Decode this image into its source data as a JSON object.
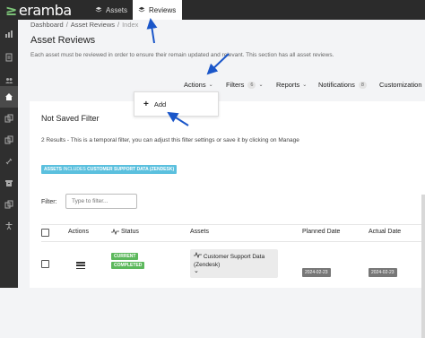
{
  "app": {
    "brand": "eramba"
  },
  "top_tabs": [
    {
      "label": "Assets",
      "icon": "layers-icon"
    },
    {
      "label": "Reviews",
      "icon": "layers-icon",
      "active": true
    }
  ],
  "sidebar": {
    "items": [
      {
        "icon": "chart-icon"
      },
      {
        "icon": "document-icon"
      },
      {
        "icon": "users-icon"
      },
      {
        "icon": "home-icon",
        "active": true
      },
      {
        "icon": "copy-icon"
      },
      {
        "icon": "copy-icon"
      },
      {
        "icon": "link-icon"
      },
      {
        "icon": "box-icon"
      },
      {
        "icon": "copy-icon"
      },
      {
        "icon": "accessibility-icon"
      }
    ]
  },
  "breadcrumb": {
    "items": [
      "Dashboard",
      "Asset Reviews",
      "Index"
    ]
  },
  "page": {
    "title": "Asset Reviews",
    "description": "Each asset must be reviewed in order to ensure their remain updated and relevant. This section has all asset reviews."
  },
  "toolbar": {
    "actions": "Actions",
    "filters": "Filters",
    "filters_count": "6",
    "reports": "Reports",
    "notifications": "Notifications",
    "notifications_count": "8",
    "customization": "Customization"
  },
  "actions_menu": {
    "add": "Add"
  },
  "card": {
    "title": "Not Saved Filter",
    "info": "2 Results - This is a temporal filter, you can adjust this filter settings or save it by clicking on Manage",
    "chip_prefix": "ASSETS",
    "chip_op": "INCLUDES",
    "chip_value": "CUSTOMER SUPPORT DATA (ZENDESK)",
    "filter_label": "Filter:",
    "filter_placeholder": "Type to filter..."
  },
  "table": {
    "columns": [
      "Actions",
      "Status",
      "Assets",
      "Planned Date",
      "Actual Date"
    ],
    "rows": [
      {
        "status": [
          "CURRENT",
          "COMPLETED"
        ],
        "asset": "Customer Support Data (Zendesk)",
        "planned": "2024-02-23",
        "actual": "2024-02-23"
      }
    ]
  },
  "colors": {
    "accent": "#5bc0de",
    "success": "#5cb85c",
    "brand_green": "#7ec77a",
    "arrow": "#1a56c9"
  }
}
